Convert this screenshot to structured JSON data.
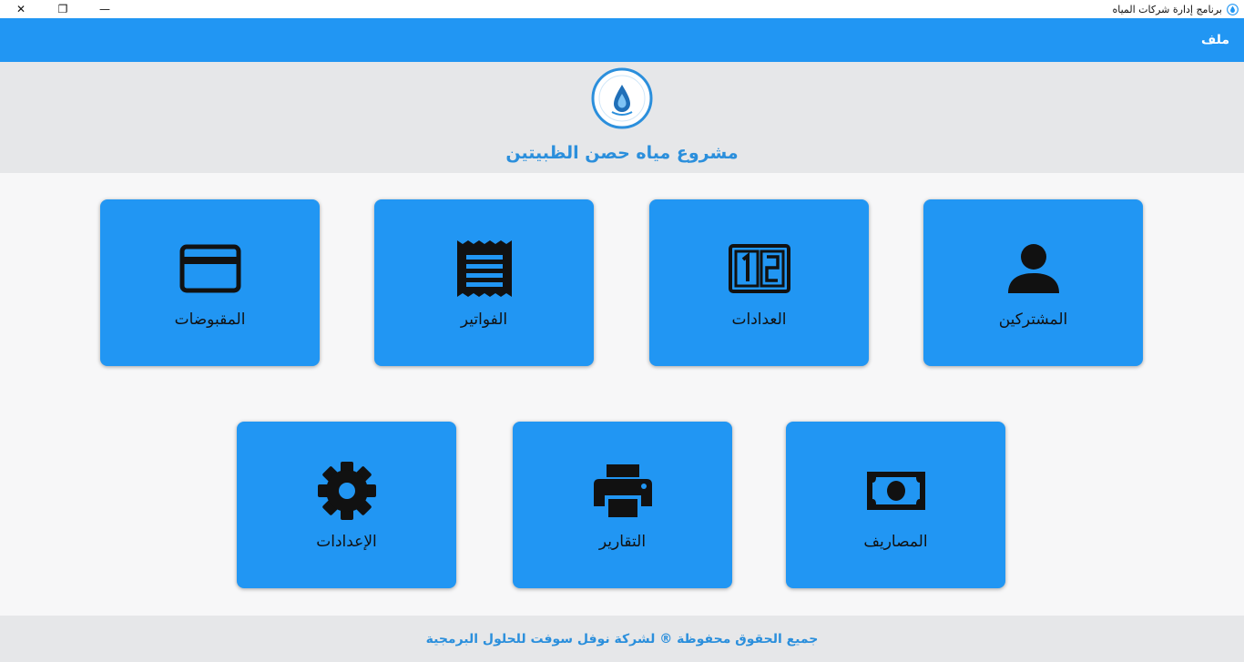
{
  "window": {
    "title": "برنامج إدارة شركات المياه",
    "controls": {
      "minimize": "—",
      "maximize": "❐",
      "close": "✕"
    }
  },
  "menu": {
    "items": [
      {
        "label": "ملف"
      }
    ]
  },
  "header": {
    "project_title": "مشروع مياه حصن الظبيتين"
  },
  "tiles": [
    {
      "label": "المشتركين",
      "icon": "user-icon"
    },
    {
      "label": "العدادات",
      "icon": "counter-icon"
    },
    {
      "label": "الفواتير",
      "icon": "receipt-icon"
    },
    {
      "label": "المقبوضات",
      "icon": "credit-card-icon"
    },
    {
      "label": "المصاريف",
      "icon": "money-icon"
    },
    {
      "label": "التقارير",
      "icon": "printer-icon"
    },
    {
      "label": "الإعدادات",
      "icon": "gear-icon"
    }
  ],
  "footer": {
    "text": "جميع الحقوق محفوظة ® لشركة نوفل سوفت للحلول البرمجية"
  },
  "colors": {
    "primary": "#2196f3",
    "accent_text": "#2b8fdc",
    "header_bg": "#e6e7e9",
    "body_bg": "#f7f7f8"
  }
}
